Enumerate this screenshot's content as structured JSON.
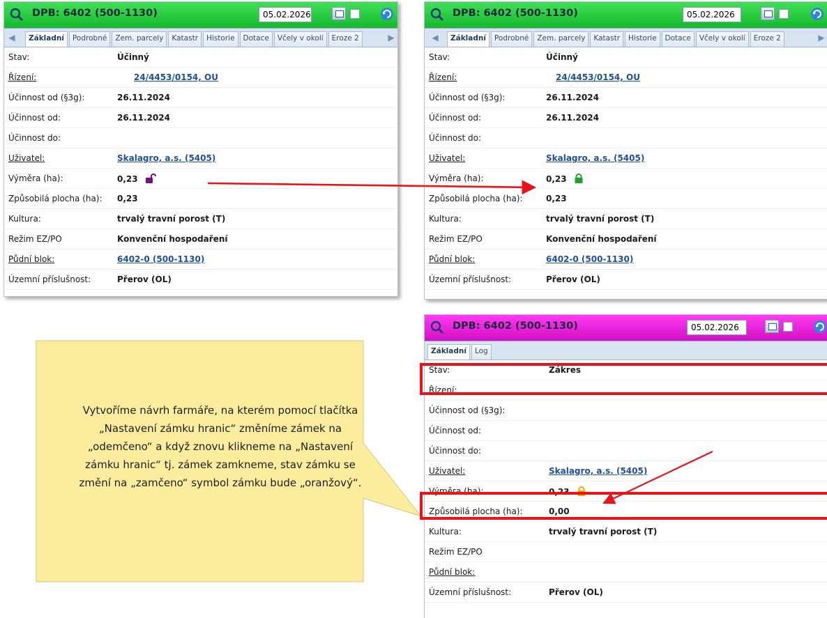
{
  "panel_common": {
    "title": "DPB: 6402 (500-1130)",
    "date": "05.02.2026"
  },
  "tabs_full": [
    "Základní",
    "Podrobné",
    "Zem. parcely",
    "Katastr",
    "Historie",
    "Dotace",
    "Včely v okolí",
    "Eroze 2"
  ],
  "tabs_short": [
    "Základní",
    "Log"
  ],
  "labels": {
    "stav": "Stav:",
    "rizeni": "Řízení:",
    "ucinnost_3g": "Účinnost od (§3g):",
    "ucinnost_od": "Účinnost od:",
    "ucinnost_do": "Účinnost do:",
    "uzivatel": "Uživatel:",
    "vymera": "Výměra (ha):",
    "zpusobila": "Způsobilá plocha (ha):",
    "kultura": "Kultura:",
    "rezim": "Režim EZ/PO",
    "pudni_blok": "Půdní blok:",
    "uzemni": "Územní příslušnost:"
  },
  "panel_left": {
    "stav": "Účinný",
    "rizeni": "24/4453/0154, OU",
    "ucinnost_3g": "26.11.2024",
    "ucinnost_od": "26.11.2024",
    "ucinnost_do": "",
    "uzivatel": "Skalagro, a.s. (5405)",
    "vymera": "0,23",
    "zpusobila": "0,23",
    "kultura": "trvalý travní porost (T)",
    "rezim": "Konvenční hospodaření",
    "pudni_blok": "6402-0 (500-1130)",
    "uzemni": "Přerov (OL)"
  },
  "panel_right_top": {
    "stav": "Účinný",
    "rizeni": "24/4453/0154, OU",
    "ucinnost_3g": "26.11.2024",
    "ucinnost_od": "26.11.2024",
    "ucinnost_do": "",
    "uzivatel": "Skalagro, a.s. (5405)",
    "vymera": "0,23",
    "zpusobila": "0,23",
    "kultura": "trvalý travní porost (T)",
    "rezim": "Konvenční hospodaření",
    "pudni_blok": "6402-0 (500-1130)",
    "uzemni": "Přerov (OL)"
  },
  "panel_right_bottom": {
    "stav": "Zákres",
    "rizeni": "",
    "ucinnost_3g": "",
    "ucinnost_od": "",
    "ucinnost_do": "",
    "uzivatel": "Skalagro, a.s. (5405)",
    "vymera": "0,23",
    "zpusobila": "0,00",
    "kultura": "trvalý travní porost (T)",
    "rezim": "",
    "pudni_blok": "",
    "uzemni": "Přerov (OL)"
  },
  "callout": {
    "text": "Vytvoříme návrh farmáře, na kterém pomocí tlačítka „Nastavení zámku hranic“ změníme zámek na „odemčeno“ a když znovu klikneme na „Nastavení zámku hranic“ tj. zámek zamkneme, stav zámku se změní na „zamčeno“ symbol zámku bude „oranžový“."
  },
  "colors": {
    "titlebar_green": "#22cc3c",
    "titlebar_magenta": "#e619d9",
    "link_blue": "#1f4f97",
    "lock_unlocked": "#7a0c84",
    "lock_green": "#1fa32c",
    "lock_orange": "#f5a300",
    "highlight_red": "#e8141b",
    "callout_fill": "#fcec9e"
  },
  "icons": [
    "search-icon",
    "calendar-icon",
    "refresh-icon",
    "lock-unlocked-icon",
    "lock-locked-green-icon",
    "lock-locked-orange-icon"
  ]
}
